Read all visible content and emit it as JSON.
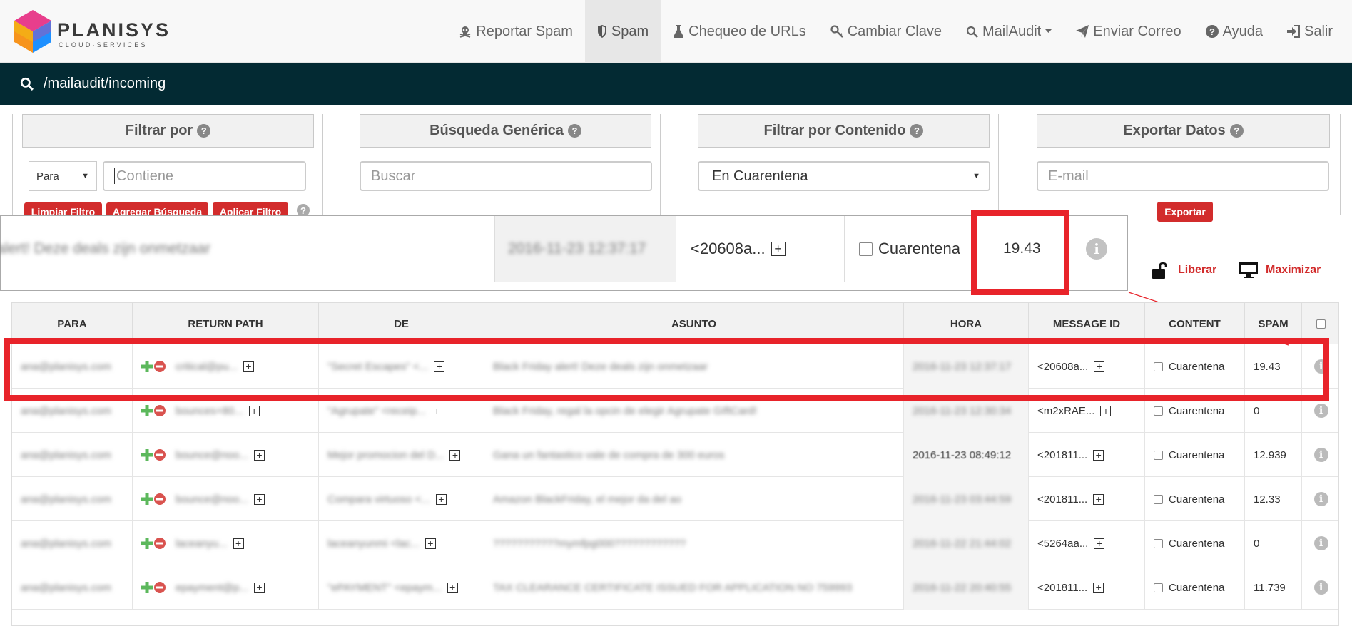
{
  "brand": {
    "name": "PLANISYS",
    "tagline": "CLOUD·SERVICES"
  },
  "nav": [
    {
      "label": "Reportar Spam",
      "icon": "skull-icon",
      "active": false
    },
    {
      "label": "Spam",
      "icon": "shield-icon",
      "active": true
    },
    {
      "label": "Chequeo de URLs",
      "icon": "flask-icon",
      "active": false
    },
    {
      "label": "Cambiar Clave",
      "icon": "key-icon",
      "active": false
    },
    {
      "label": "MailAudit",
      "icon": "search-icon",
      "active": false,
      "dropdown": true
    },
    {
      "label": "Enviar Correo",
      "icon": "paper-plane-icon",
      "active": false
    },
    {
      "label": "Ayuda",
      "icon": "question-circle-icon",
      "active": false
    },
    {
      "label": "Salir",
      "icon": "sign-out-icon",
      "active": false
    }
  ],
  "path": "/mailaudit/incoming",
  "filters": {
    "filtrar_por": {
      "title": "Filtrar por",
      "select_value": "Para",
      "input_placeholder": "Contiene",
      "buttons": [
        "Limpiar Filtro",
        "Agregar Búsqueda",
        "Aplicar Filtro"
      ]
    },
    "busqueda": {
      "title": "Búsqueda Genérica",
      "placeholder": "Buscar"
    },
    "contenido": {
      "title": "Filtrar por Contenido",
      "select_value": "En Cuarentena"
    },
    "exportar": {
      "title": "Exportar Datos",
      "placeholder": "E-mail",
      "button": "Exportar"
    }
  },
  "zoom": {
    "subject_fragment": "alert! Deze deals zijn onmetzaar",
    "hora": "2016-11-23 12:37:17",
    "message_id": "<20608a...",
    "content_label": "Cuarentena",
    "spam": "19.43"
  },
  "actions": {
    "liberar": "Liberar",
    "maximizar": "Maximizar"
  },
  "table": {
    "columns": [
      "PARA",
      "RETURN PATH",
      "DE",
      "ASUNTO",
      "HORA",
      "MESSAGE ID",
      "CONTENT",
      "SPAM"
    ],
    "rows": [
      {
        "para": "ana@planisys.com",
        "return_path": "critical@pu...",
        "de": "\"Secret Escapes\" <...",
        "asunto": "Black Friday alert! Deze deals zijn onmetzaar",
        "hora": "2016-11-23 12:37:17",
        "message_id": "<20608a...",
        "content": "Cuarentena",
        "spam": "19.43",
        "highlight": true
      },
      {
        "para": "ana@planisys.com",
        "return_path": "bounces+80...",
        "de": "\"Agrupate\" <receip...",
        "asunto": "Black Friday, regal la opcin de elegir Agrupate GIftCard!",
        "hora": "2016-11-23 12:30:34",
        "message_id": "<m2xRAE...",
        "content": "Cuarentena",
        "spam": "0"
      },
      {
        "para": "ana@planisys.com",
        "return_path": "bounce@noo...",
        "de": "Mejor promocion del D...",
        "asunto": "Gana un fantastico vale de compra de 300 euros",
        "hora": "2016-11-23 08:49:12",
        "message_id": "<201811...",
        "content": "Cuarentena",
        "spam": "12.939"
      },
      {
        "para": "ana@planisys.com",
        "return_path": "bounce@noo...",
        "de": "Compara virtuoso <...",
        "asunto": "Amazon BlackFriday, el mejor da del ao",
        "hora": "2016-11-23 03:44:59",
        "message_id": "<201811...",
        "content": "Cuarentena",
        "spam": "12.33"
      },
      {
        "para": "ana@planisys.com",
        "return_path": "laceanyu...",
        "de": "laceanyunmi <lac...",
        "asunto": "???????????mymfpg000????????????",
        "hora": "2016-11-22 21:44:02",
        "message_id": "<5264aa...",
        "content": "Cuarentena",
        "spam": "0"
      },
      {
        "para": "ana@planisys.com",
        "return_path": "epayment@p...",
        "de": "\"ePAYMENT\" <epaym...",
        "asunto": "TAX CLEARANCE CERTIFICATE ISSUED FOR APPLICATION NO 759993",
        "hora": "2016-11-22 20:40:55",
        "message_id": "<201811...",
        "content": "Cuarentena",
        "spam": "11.739"
      }
    ]
  },
  "colors": {
    "accent": "#d22c2c",
    "pathbar": "#032a33",
    "highlight": "#e8232a"
  }
}
